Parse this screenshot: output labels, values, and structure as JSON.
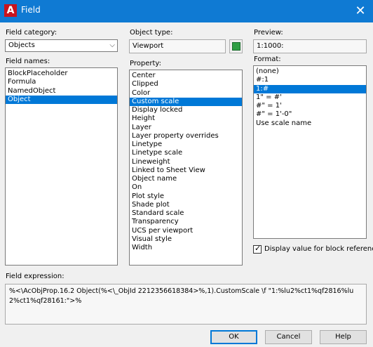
{
  "window": {
    "title": "Field",
    "app_icon": "A"
  },
  "field_category": {
    "label": "Field category:",
    "value": "Objects"
  },
  "field_names": {
    "label": "Field names:",
    "items": [
      "BlockPlaceholder",
      "Formula",
      "NamedObject",
      "Object"
    ],
    "selected": 3
  },
  "object_type": {
    "label": "Object type:",
    "value": "Viewport"
  },
  "property": {
    "label": "Property:",
    "items": [
      "Center",
      "Clipped",
      "Color",
      "Custom scale",
      "Display locked",
      "Height",
      "Layer",
      "Layer property overrides",
      "Linetype",
      "Linetype scale",
      "Lineweight",
      "Linked to Sheet View",
      "Object name",
      "On",
      "Plot style",
      "Shade plot",
      "Standard scale",
      "Transparency",
      "UCS per viewport",
      "Visual style",
      "Width"
    ],
    "selected": 3
  },
  "preview": {
    "label": "Preview:",
    "value": "1:1000:"
  },
  "format": {
    "label": "Format:",
    "items": [
      "(none)",
      "#:1",
      "1:#",
      "1\" = #'",
      "#\" = 1'",
      "#\" = 1'-0\"",
      "Use scale name"
    ],
    "selected": 2
  },
  "display_value": {
    "label": "Display value for block reference",
    "checked": true
  },
  "field_expression": {
    "label": "Field expression:",
    "value": "%<\\AcObjProp.16.2 Object(%<\\_ObjId 2212356618384>%,1).CustomScale \\f \"1:%lu2%ct1%qf2816%lu2%ct1%qf28161:\">%"
  },
  "buttons": {
    "ok": "OK",
    "cancel": "Cancel",
    "help": "Help"
  },
  "colors": {
    "titlebar": "#0f7ad3",
    "selection": "#0078d7",
    "app_icon": "#c8141e",
    "pick_button": "#2f9e44"
  }
}
